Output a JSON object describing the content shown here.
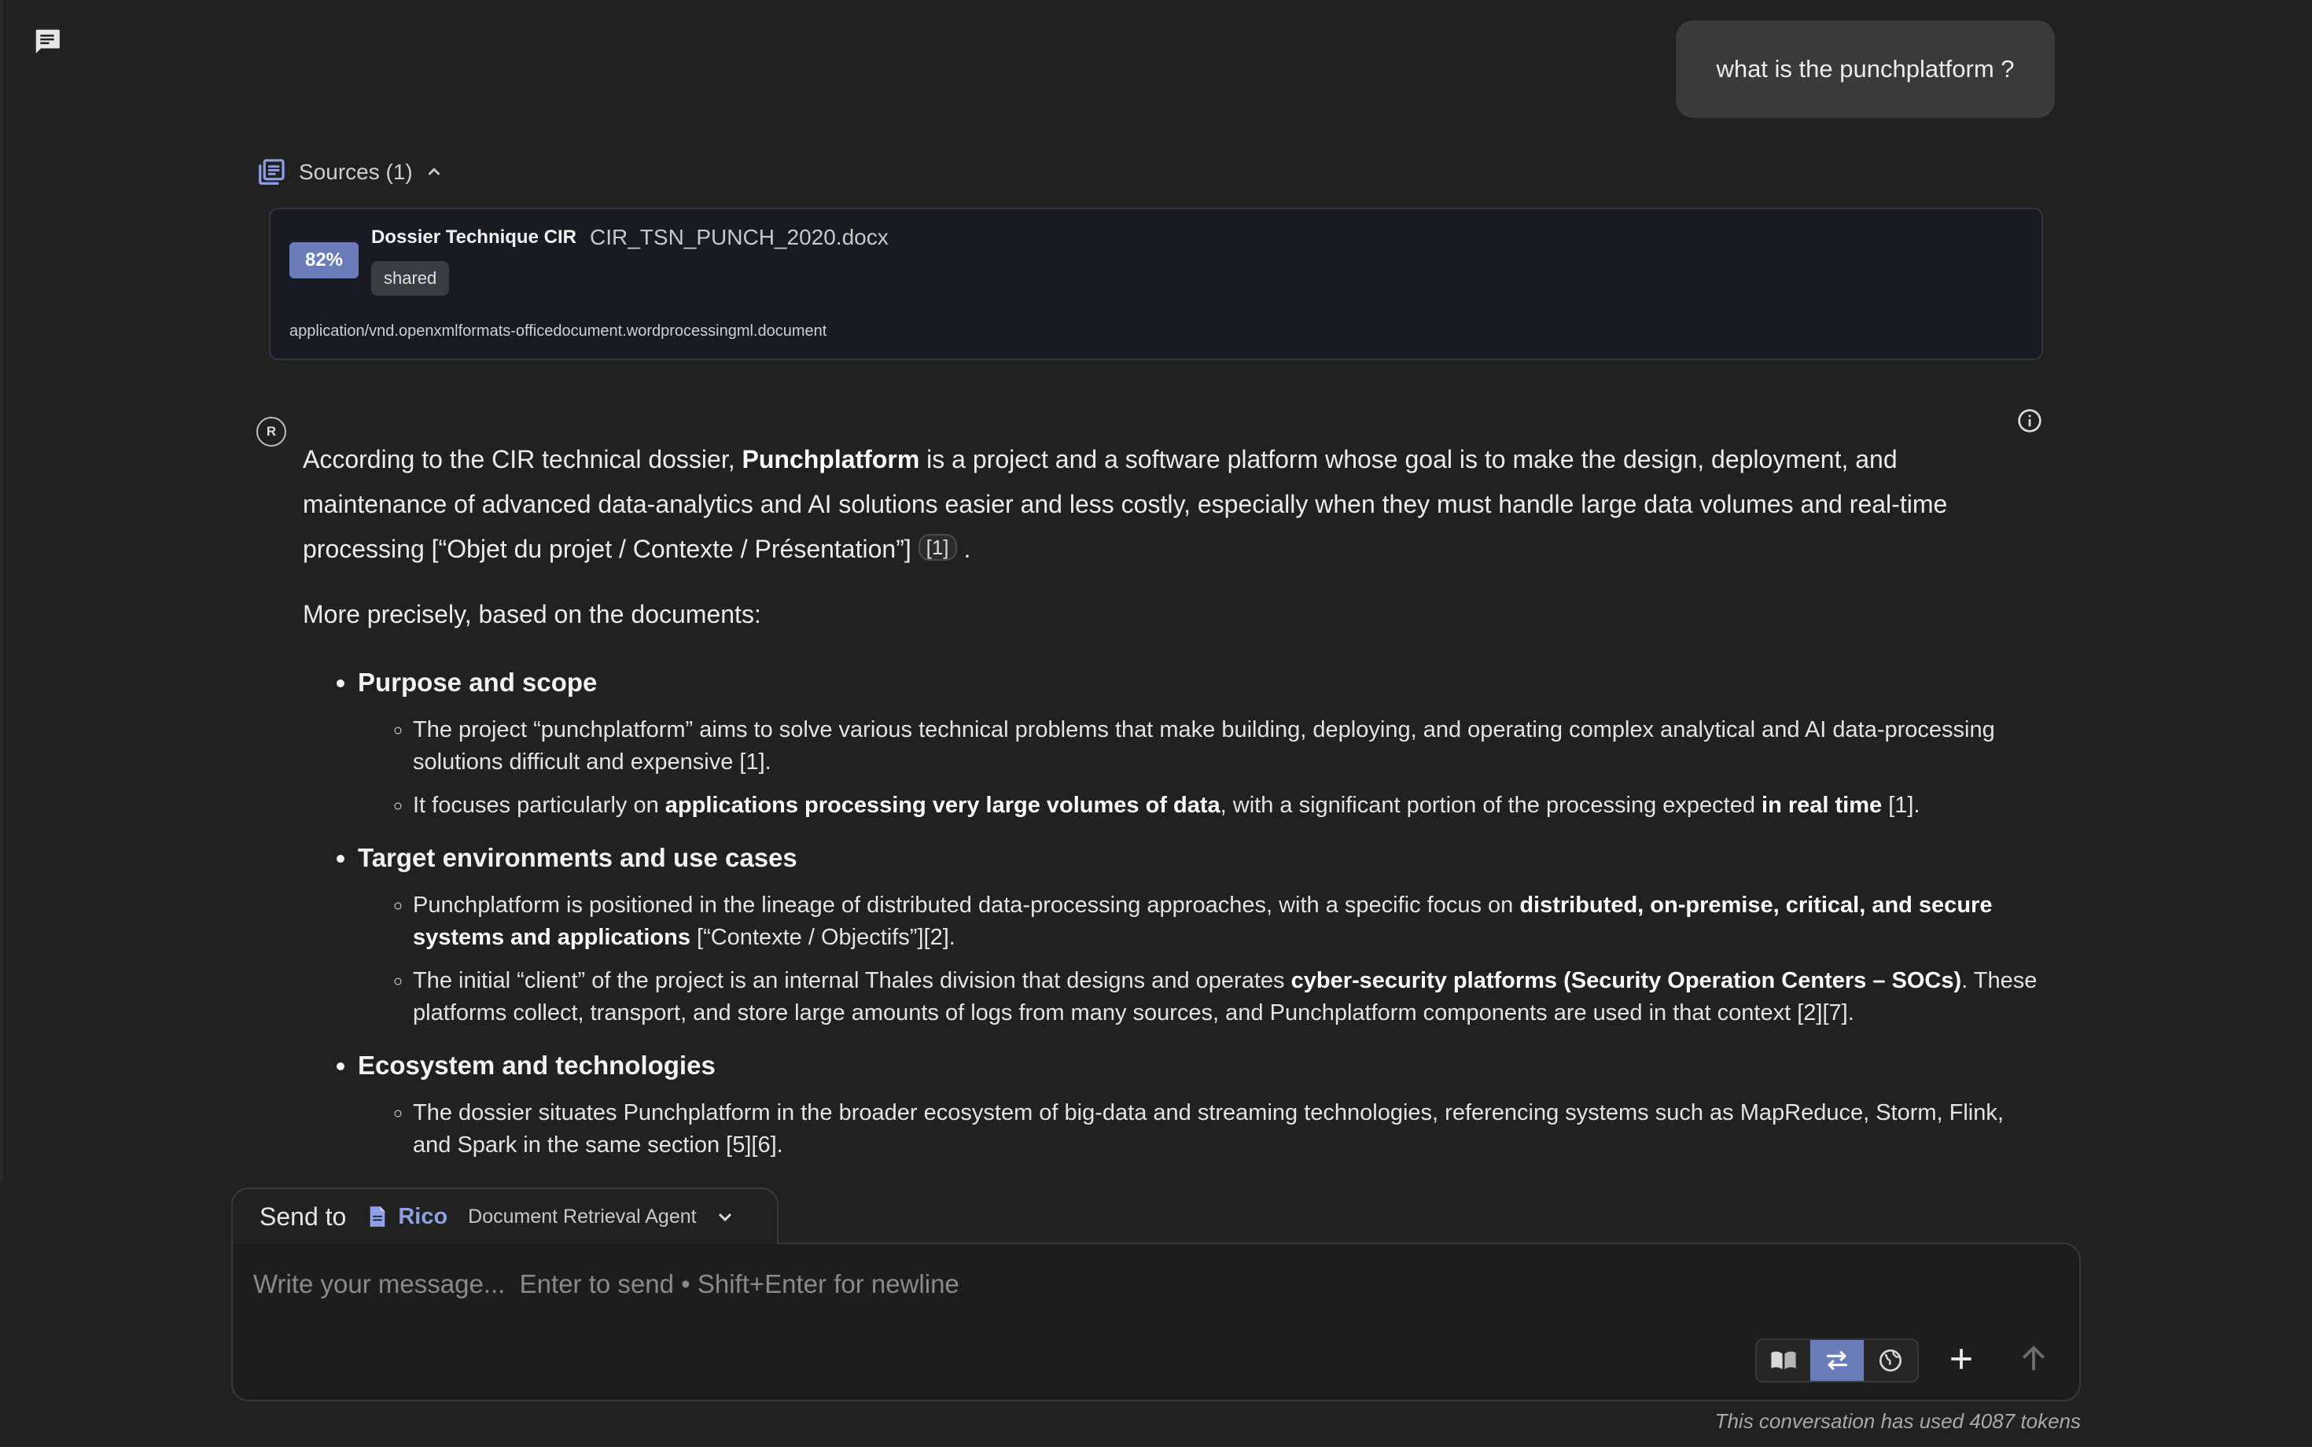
{
  "user_message": "what is the punchplatform ?",
  "sources": {
    "label": "Sources (1)",
    "items": [
      {
        "score": "82%",
        "title": "Dossier Technique CIR",
        "filename": "CIR_TSN_PUNCH_2020.docx",
        "tag": "shared",
        "mime": "application/vnd.openxmlformats-officedocument.wordprocessingml.document"
      }
    ]
  },
  "agent": {
    "avatar_letter": "R"
  },
  "answer": {
    "p1_a": "According to the CIR technical dossier, ",
    "p1_bold": "Punchplatform",
    "p1_b": " is a project and a software platform whose goal is to make the design, deployment, and maintenance of advanced data-analytics and AI solutions easier and less costly, especially when they must handle large data volumes and real-time processing [“Objet du projet / Contexte / Présentation”]",
    "p1_cite": "[1]",
    "p1_end": ".",
    "p2": "More precisely, based on the documents:",
    "sections": [
      {
        "heading": "Purpose and scope",
        "items": [
          {
            "t1": "The project “punchplatform” aims to solve various technical problems that make building, deploying, and operating complex analytical and AI data-processing solutions difficult and expensive [1]."
          },
          {
            "t1": "It focuses particularly on ",
            "b1": "applications processing very large volumes of data",
            "t2": ", with a significant portion of the processing expected ",
            "b2": "in real time",
            "t3": " [1]."
          }
        ]
      },
      {
        "heading": "Target environments and use cases",
        "items": [
          {
            "t1": "Punchplatform is positioned in the lineage of distributed data-processing approaches, with a specific focus on ",
            "b1": "distributed, on-premise, critical, and secure systems and applications",
            "t2": " [“Contexte / Objectifs”][2]."
          },
          {
            "t1": "The initial “client” of the project is an internal Thales division that designs and operates ",
            "b1": "cyber-security platforms (Security Operation Centers – SOCs)",
            "t2": ". These platforms collect, transport, and store large amounts of logs from many sources, and Punchplatform components are used in that context [2][7]."
          }
        ]
      },
      {
        "heading": "Ecosystem and technologies",
        "items": [
          {
            "t1": "The dossier situates Punchplatform in the broader ecosystem of big-data and streaming technologies, referencing systems such as MapReduce, Storm, Flink, and Spark in the same section [5][6]."
          }
        ]
      }
    ]
  },
  "composer": {
    "send_to_label": "Send to",
    "agent_name": "Rico",
    "agent_role": "Document Retrieval Agent",
    "placeholder": "Write your message...  Enter to send • Shift+Enter for newline"
  },
  "footer": {
    "token_note": "This conversation has used 4087 tokens"
  },
  "colors": {
    "accent": "#6b7cbb",
    "agent_link": "#8ea0e6",
    "background": "#212121"
  }
}
